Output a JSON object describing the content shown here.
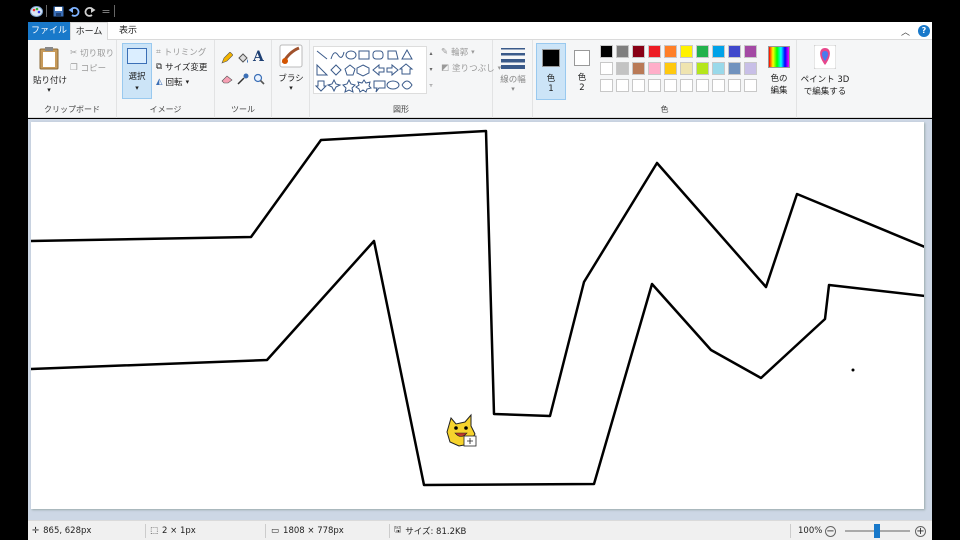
{
  "quick_access": {
    "app_icon": "paint-palette-icon",
    "save_icon": "save-icon",
    "undo_icon": "undo-icon",
    "redo_icon": "redo-icon",
    "customize_icon": "dropdown-icon"
  },
  "tabs": {
    "file": "ファイル",
    "home": "ホーム",
    "view": "表示"
  },
  "ribbon": {
    "clipboard": {
      "label": "クリップボード",
      "paste": "貼り付け",
      "cut": "切り取り",
      "copy": "コピー"
    },
    "image": {
      "label": "イメージ",
      "select": "選択",
      "crop": "トリミング",
      "resize": "サイズ変更",
      "rotate": "回転"
    },
    "tools": {
      "label": "ツール"
    },
    "brush": {
      "label": "ブラシ"
    },
    "shapes": {
      "label": "図形",
      "outline": "輪郭",
      "fill": "塗りつぶし"
    },
    "size": {
      "label": "線の幅"
    },
    "colors": {
      "label": "色",
      "color1": "色",
      "color1_num": "1",
      "color2": "色",
      "color2_num": "2",
      "edit_colors_1": "色の",
      "edit_colors_2": "編集",
      "paint3d_1": "ペイント 3D",
      "paint3d_2": "で編集する",
      "color1_value": "#000000",
      "color2_value": "#ffffff",
      "palette_row1": [
        "#000000",
        "#7f7f7f",
        "#880015",
        "#ed1c24",
        "#ff7f27",
        "#fff200",
        "#22b14c",
        "#00a2e8",
        "#3f48cc",
        "#a349a4"
      ],
      "palette_row2": [
        "#ffffff",
        "#c3c3c3",
        "#b97a57",
        "#ffaec9",
        "#ffc90e",
        "#efe4b0",
        "#b5e61d",
        "#99d9ea",
        "#7092be",
        "#c8bfe7"
      ]
    }
  },
  "status": {
    "cursor_pos": "865, 628px",
    "selection_size": "2 × 1px",
    "image_size": "1808 × 778px",
    "file_size": "サイズ: 81.2KB",
    "zoom": "100%"
  }
}
